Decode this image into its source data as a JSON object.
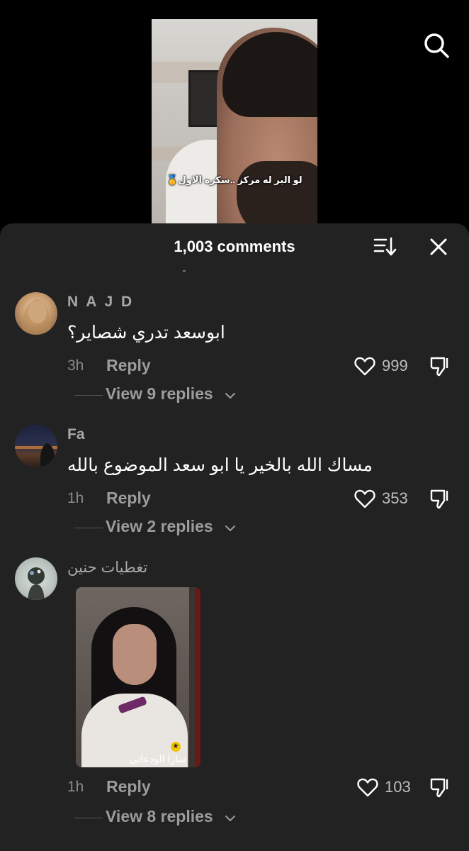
{
  "video": {
    "caption": "لو البر له مركز ..سكره الاول🥇"
  },
  "header": {
    "title": "1,003 comments"
  },
  "comments": [
    {
      "username": "N A J D",
      "text": "ابوسعد تدري شصاير؟",
      "time": "3h",
      "reply_label": "Reply",
      "likes": "999",
      "view_replies": "View 9 replies"
    },
    {
      "username": "Fa",
      "text": "مساك الله بالخير يا ابو سعد الموضوع بالله",
      "time": "1h",
      "reply_label": "Reply",
      "likes": "353",
      "view_replies": "View 2 replies"
    },
    {
      "username": "تغطيات حنين",
      "gif_label": "سارا الودعاني",
      "time": "1h",
      "reply_label": "Reply",
      "likes": "103",
      "view_replies": "View 8 replies"
    }
  ],
  "icons": {
    "search": "search-icon",
    "sort": "sort-icon",
    "close": "close-icon",
    "like": "heart-icon",
    "dislike": "thumbs-down-icon",
    "expand": "chevron-down-icon"
  },
  "colors": {
    "sheet_bg": "#222222",
    "page_bg": "#000000",
    "muted_text": "#9c9c9c"
  }
}
